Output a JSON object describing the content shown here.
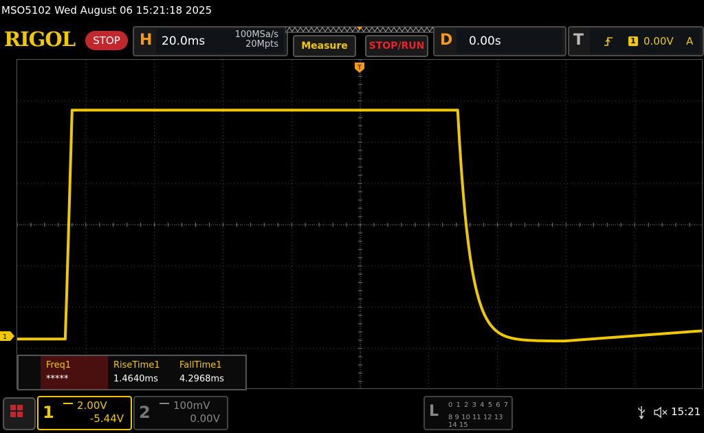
{
  "title_bar": {
    "text": "MSO5102  Wed August 06 15:21:18 2025"
  },
  "header": {
    "logo": "RIGOL",
    "run_state": "STOP",
    "horizontal": {
      "letter": "H",
      "timebase": "20.0ms",
      "sample_rate": "100MSa/s",
      "memory_depth": "20Mpts"
    },
    "measure_label": "Measure",
    "stoprun_label": "STOP/RUN",
    "delay": {
      "letter": "D",
      "value": "0.00s"
    },
    "trigger": {
      "letter": "T",
      "source": "1",
      "level": "0.00V",
      "mode": "A"
    }
  },
  "measurements": [
    {
      "name": "Freq1",
      "value": "*****"
    },
    {
      "name": "RiseTime1",
      "value": "1.4640ms"
    },
    {
      "name": "FallTime1",
      "value": "4.2968ms"
    }
  ],
  "channels": {
    "ch1": {
      "number": "1",
      "scale": "2.00V",
      "offset": "-5.44V",
      "marker": "1"
    },
    "ch2": {
      "number": "2",
      "scale": "100mV",
      "offset": "0.00V"
    }
  },
  "logic": {
    "letter": "L",
    "row1": "0 1 2 3  4 5 6 7",
    "row2": "8 9 10 11 12 13 14 15"
  },
  "status": {
    "time": "15:21"
  },
  "colors": {
    "ch1": "#f0c800",
    "ch2": "#888888",
    "brand": "#f0c800",
    "stop": "#c1272d",
    "accent": "#f39a1e"
  },
  "trace": {
    "ch1_levels_volts": {
      "low": -0.1,
      "high": 11.0,
      "settle": 0.3
    }
  }
}
